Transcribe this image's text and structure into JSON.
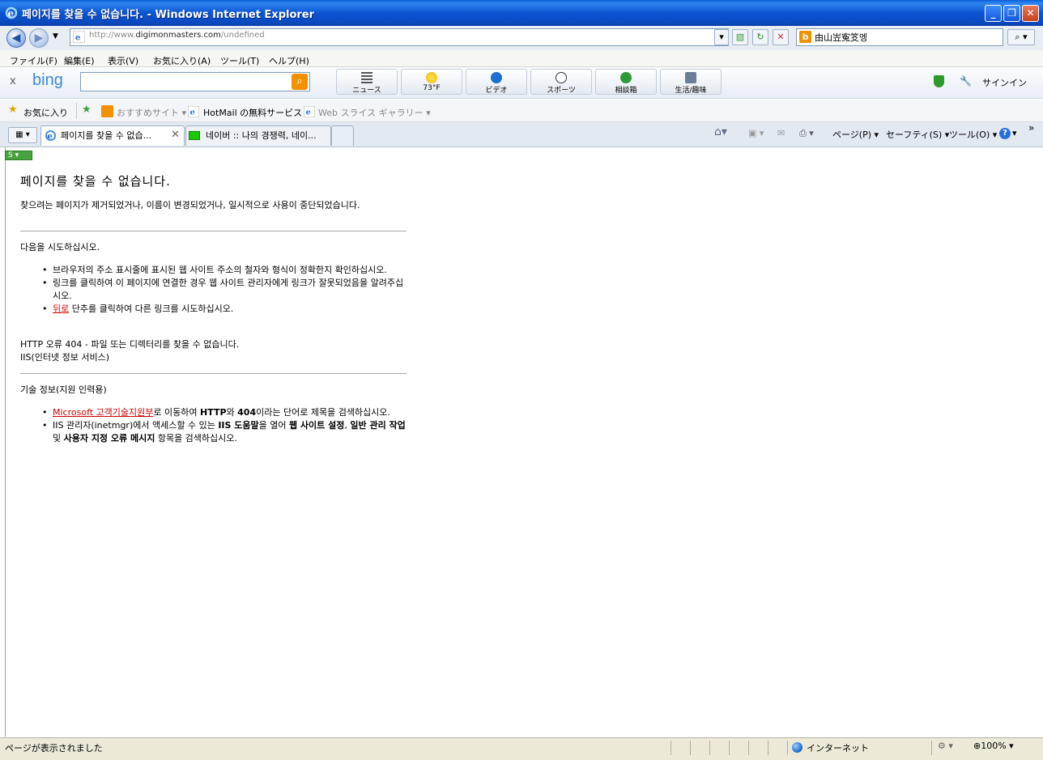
{
  "window": {
    "title": "페이지를 찾을 수 없습니다. - Windows Internet Explorer",
    "minimize": "_",
    "maximize": "❐",
    "close": "✕"
  },
  "address": {
    "url_prefix": "http://www.",
    "url_domain": "digimonmasters.com",
    "url_path": "/undefined",
    "search_value": "由山岦寃笅엥"
  },
  "menu": [
    "ファイル(F)",
    "編集(E)",
    "表示(V)",
    "お気に入り(A)",
    "ツール(T)",
    "ヘルプ(H)"
  ],
  "bing": {
    "close": "x",
    "logo": "bing",
    "buttons": [
      {
        "label": "ニュース",
        "icon": "news-icon"
      },
      {
        "label": "73°F",
        "icon": "weather-sun-icon"
      },
      {
        "label": "ビデオ",
        "icon": "video-icon"
      },
      {
        "label": "スポーツ",
        "icon": "sports-ball-icon"
      },
      {
        "label": "相談箱",
        "icon": "qa-icon"
      },
      {
        "label": "生活/趣味",
        "icon": "cup-icon"
      }
    ],
    "signin": "サインイン"
  },
  "favorites": {
    "label": "お気に入り",
    "items": [
      "おすすめサイト ▾",
      "HotMail の無料サービス",
      "Web スライス ギャラリー ▾"
    ]
  },
  "tabs": [
    {
      "label": "페이지를 찾을 수 없습..."
    },
    {
      "label": "네이버 :: 나의 경쟁력, 네이..."
    }
  ],
  "commands": {
    "page": "ページ(P) ▾",
    "safety": "セーフティ(S) ▾",
    "tools": "ツール(O) ▾",
    "more": "»"
  },
  "content": {
    "heading": "페이지를 찾을 수 없습니다.",
    "intro": "찾으려는 페이지가 제거되었거나, 이름이 변경되었거나, 일시적으로 사용이 중단되었습니다.",
    "try_heading": "다음을 시도하십시오.",
    "bullet1": "브라우저의 주소 표시줄에 표시된 웹 사이트 주소의 철자와 형식이 정확한지 확인하십시오.",
    "bullet2": "링크를 클릭하여 이 페이지에 연결한 경우 웹 사이트 관리자에게 링크가 잘못되었음을 알려주십시오.",
    "bullet3_link": "뒤로",
    "bullet3_rest": " 단추를 클릭하여 다른 링크를 시도하십시오.",
    "error_line": "HTTP 오류 404 - 파일 또는 디렉터리를 찾을 수 없습니다.",
    "iis_line": "IIS(인터넷 정보 서비스)",
    "tech_heading": "기술 정보(지원 인력용)",
    "tech1_link": "Microsoft 고객기술지원부",
    "tech1_a": "로 이동하여 ",
    "tech1_b1": "HTTP",
    "tech1_c": "와 ",
    "tech1_b2": "404",
    "tech1_d": "이라는 단어로 제목을 검색하십시오.",
    "tech2_a": "IIS 관리자(inetmgr)에서 액세스할 수 있는 ",
    "tech2_b1": "IIS 도움말",
    "tech2_c": "을 열어 ",
    "tech2_b2": "웹 사이트 설정",
    "tech2_d": ", ",
    "tech2_b3": "일반 관리 작업",
    "tech2_e": " 및 ",
    "tech2_b4": "사용자 지정 오류 메시지",
    "tech2_f": " 항목을 검색하십시오."
  },
  "status": {
    "text": "ページが表示されました",
    "zone": "インターネット",
    "zoom": "100%"
  },
  "colors": {
    "titlebar": "#0a5fd8",
    "link": "#cc0000",
    "bing_orange": "#f29100"
  }
}
